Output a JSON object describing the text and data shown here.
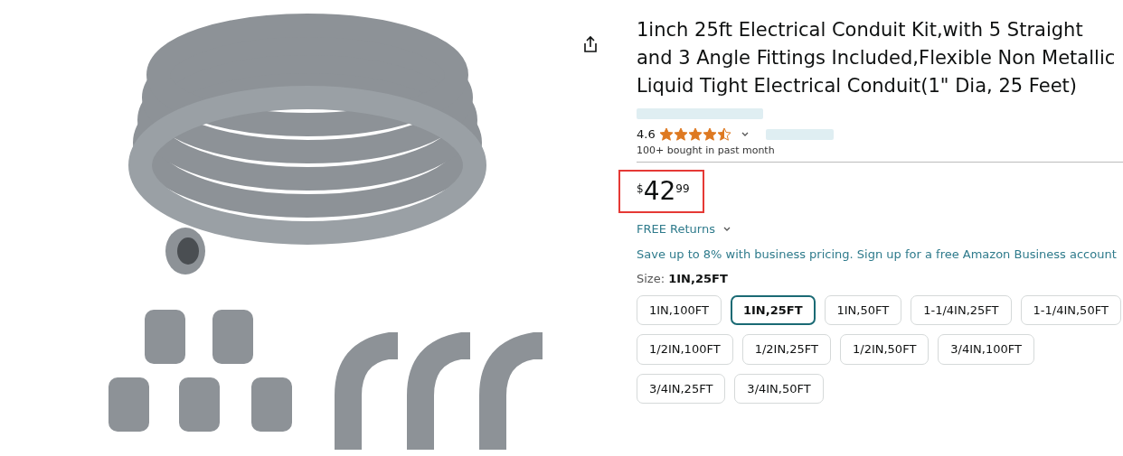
{
  "title": "1inch 25ft Electrical Conduit Kit,with 5 Straight and 3 Angle Fittings Included,Flexible Non Metallic Liquid Tight Electrical Conduit(1\" Dia, 25 Feet)",
  "rating": {
    "value": "4.6",
    "stars": 4.5
  },
  "bought": "100+ bought in past month",
  "price": {
    "currency": "$",
    "whole": "42",
    "fraction": "99",
    "highlighted": true
  },
  "returns": "FREE Returns",
  "business": "Save up to 8% with business pricing. Sign up for a free Amazon Business account",
  "size": {
    "label": "Size:",
    "value": "1IN,25FT"
  },
  "options": [
    {
      "label": "1IN,100FT",
      "selected": false
    },
    {
      "label": "1IN,25FT",
      "selected": true
    },
    {
      "label": "1IN,50FT",
      "selected": false
    },
    {
      "label": "1-1/4IN,25FT",
      "selected": false
    },
    {
      "label": "1-1/4IN,50FT",
      "selected": false
    },
    {
      "label": "1/2IN,100FT",
      "selected": false
    },
    {
      "label": "1/2IN,25FT",
      "selected": false
    },
    {
      "label": "1/2IN,50FT",
      "selected": false
    },
    {
      "label": "3/4IN,100FT",
      "selected": false
    },
    {
      "label": "3/4IN,25FT",
      "selected": false
    },
    {
      "label": "3/4IN,50FT",
      "selected": false
    }
  ]
}
